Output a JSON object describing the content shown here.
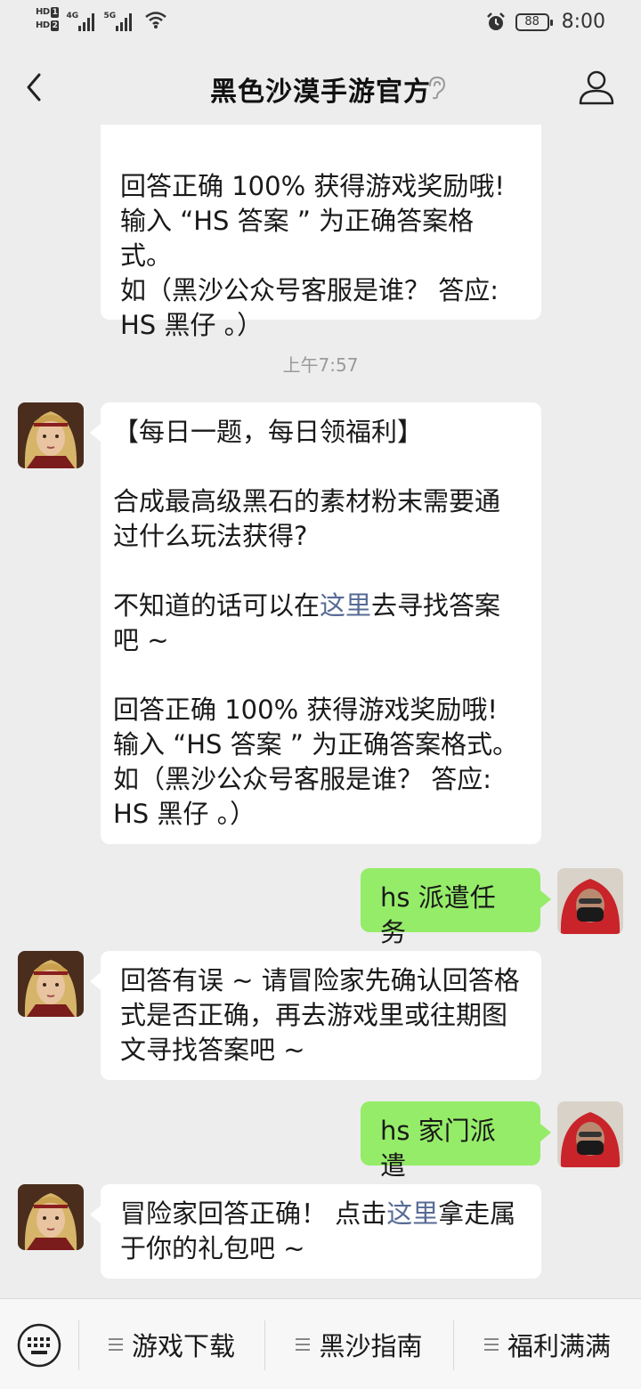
{
  "status_bar": {
    "hd1": "HD",
    "hd1_num": "1",
    "hd2": "HD",
    "hd2_num": "2",
    "net1": "4G",
    "net2": "5G",
    "battery": "88",
    "time": "8:00"
  },
  "nav": {
    "title": "黑色沙漠手游官方"
  },
  "messages": {
    "m1_text": "回答正确 100% 获得游戏奖励哦!\n输入 “HS 答案 ” 为正确答案格式。\n如（黑沙公众号客服是谁？ 答应:\nHS 黑仔 。）",
    "timestamp": "上午7:57",
    "m2_part1": "【每日一题，每日领福利】\n\n合成最高级黑石的素材粉末需要通过什么玩法获得?\n\n不知道的话可以在",
    "m2_link": "这里",
    "m2_part2": "去寻找答案吧 ~\n\n回答正确 100% 获得游戏奖励哦!\n输入 “HS 答案 ” 为正确答案格式。\n如（黑沙公众号客服是谁？ 答应:\nHS 黑仔 。）",
    "m3_text": "hs 派遣任务",
    "m4_text": "回答有误 ~ 请冒险家先确认回答格式是否正确，再去游戏里或往期图文寻找答案吧 ~",
    "m5_text": "hs 家门派遣",
    "m6_part1": "冒险家回答正确！ 点击",
    "m6_link": "这里",
    "m6_part2": "拿走属于你的礼包吧 ~"
  },
  "menu": {
    "item1": "游戏下载",
    "item2": "黑沙指南",
    "item3": "福利满满"
  },
  "icons": {
    "back": "chevron-left-icon",
    "ear": "ear-icon",
    "profile": "person-icon",
    "keyboard": "keyboard-icon",
    "alarm": "alarm-clock-icon",
    "wifi": "wifi-icon"
  },
  "colors": {
    "background": "#ededed",
    "incoming_bubble": "#ffffff",
    "outgoing_bubble": "#95ec69",
    "link": "#576b95"
  }
}
